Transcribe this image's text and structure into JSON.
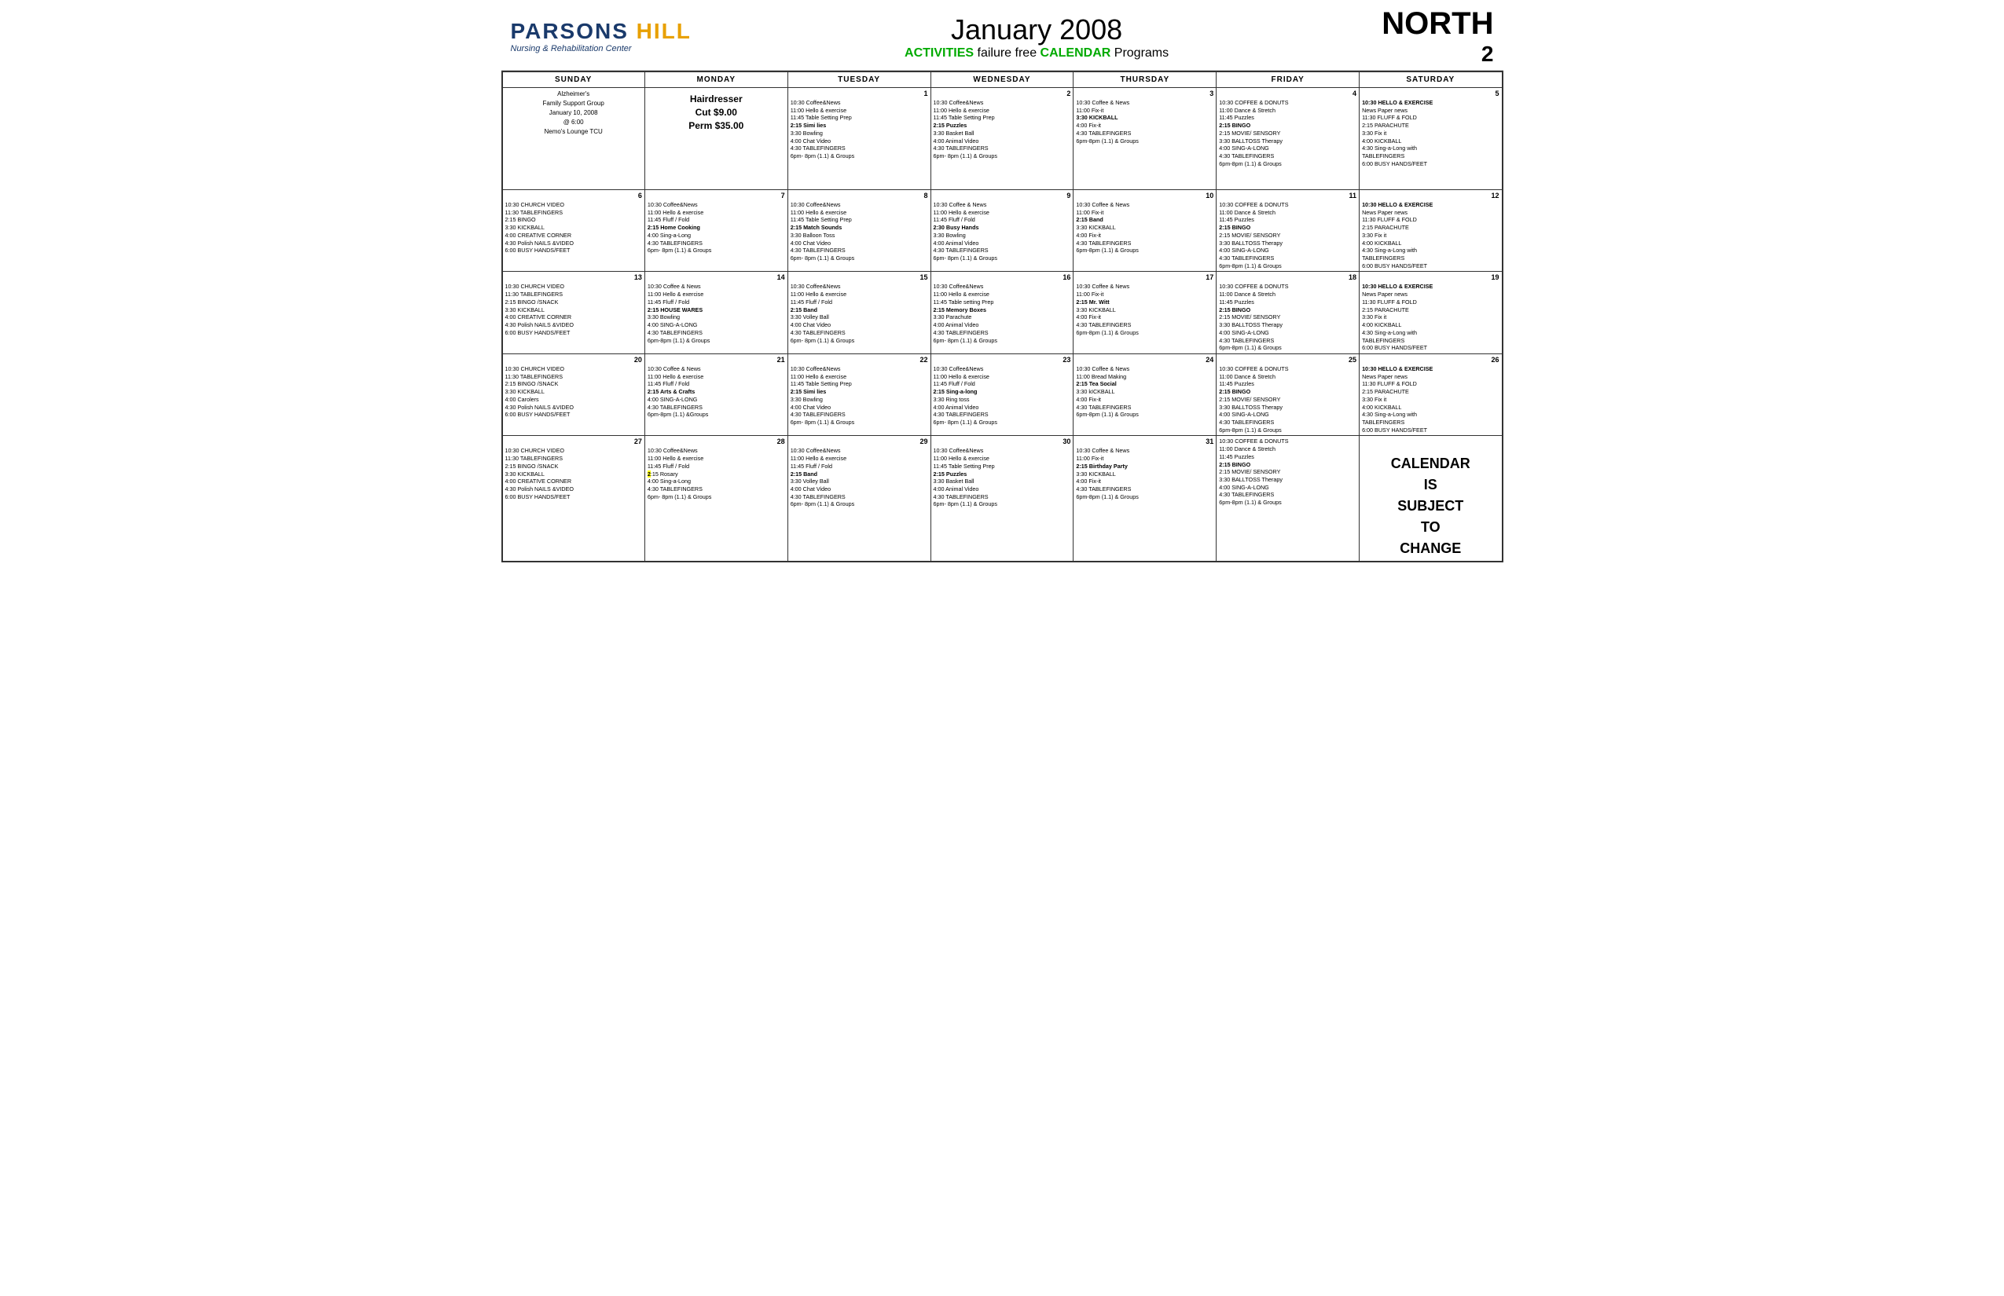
{
  "header": {
    "logo_parsons": "PARSONS",
    "logo_hill": "HILL",
    "logo_subtitle": "Nursing & Rehabilitation Center",
    "month_title": "January 2008",
    "subtitle": "ACTIVITIES failure free CALENDAR Programs",
    "subtitle_activities": "ACTIVITIES",
    "subtitle_calendar": "CALENDAR",
    "subtitle_middle": " failure free ",
    "subtitle_end": " Programs",
    "region": "NORTH",
    "region_num": "2"
  },
  "days_of_week": [
    "SUNDAY",
    "MONDAY",
    "TUESDAY",
    "WEDNESDAY",
    "THURSDAY",
    "FRIDAY",
    "SATURDAY"
  ],
  "calendar_change_text": "CALENDAR IS SUBJECT TO CHANGE"
}
